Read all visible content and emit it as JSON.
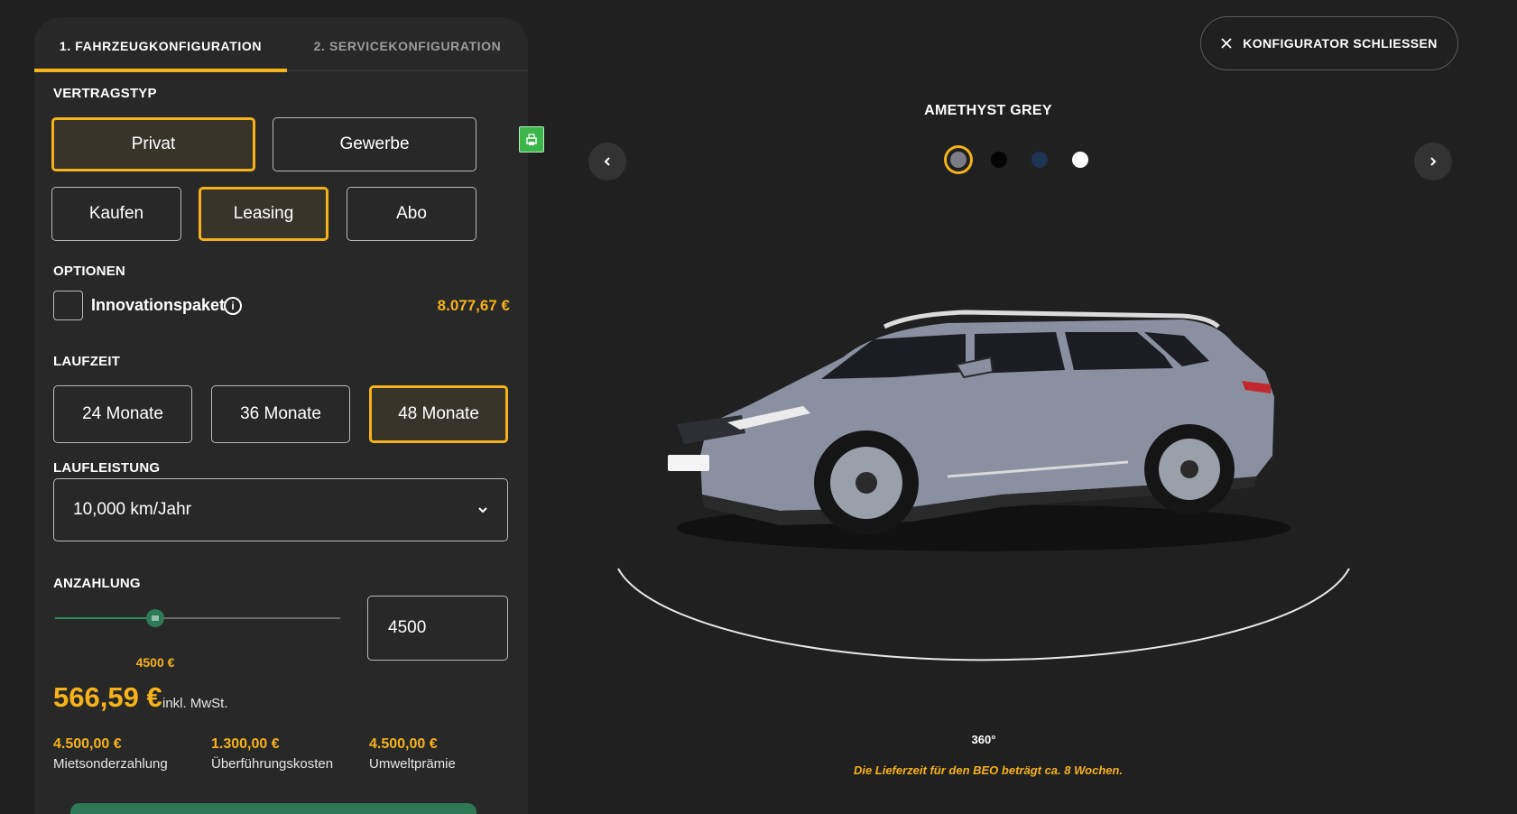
{
  "tabs": [
    {
      "label": "1. FAHRZEUGKONFIGURATION",
      "active": true
    },
    {
      "label": "2. SERVICEKONFIGURATION",
      "active": false
    }
  ],
  "contract": {
    "label": "VERTRAGSTYP",
    "customer_types": [
      {
        "label": "Privat",
        "selected": true
      },
      {
        "label": "Gewerbe",
        "selected": false
      }
    ],
    "purchase_types": [
      {
        "label": "Kaufen",
        "selected": false
      },
      {
        "label": "Leasing",
        "selected": true
      },
      {
        "label": "Abo",
        "selected": false
      }
    ]
  },
  "options": {
    "label": "OPTIONEN",
    "innovation_package": {
      "label": "Innovationspaket",
      "price": "8.077,67 €",
      "checked": false,
      "info_icon": "info-icon"
    }
  },
  "term": {
    "label": "LAUFZEIT",
    "items": [
      {
        "label": "24 Monate",
        "selected": false
      },
      {
        "label": "36 Monate",
        "selected": false
      },
      {
        "label": "48 Monate",
        "selected": true
      }
    ]
  },
  "mileage": {
    "label": "LAUFLEISTUNG",
    "selected": "10,000 km/Jahr"
  },
  "deposit": {
    "label": "ANZAHLUNG",
    "slider_label": "4500 €",
    "input_value": "4500",
    "fraction": 0.35
  },
  "price": {
    "monthly": "566,59 €",
    "note": "inkl. MwSt."
  },
  "costs": [
    {
      "value": "4.500,00 €",
      "label": "Mietsonderzahlung"
    },
    {
      "value": "1.300,00 €",
      "label": "Überführungskosten"
    },
    {
      "value": "4.500,00 €",
      "label": "Umweltprämie"
    }
  ],
  "viewer": {
    "close_label": "KONFIGURATOR SCHLIESSEN",
    "color_name": "AMETHYST GREY",
    "swatches": [
      {
        "name": "Amethyst Grey",
        "hex": "#7c7c86",
        "selected": true
      },
      {
        "name": "Black",
        "hex": "#050505",
        "selected": false
      },
      {
        "name": "Blue",
        "hex": "#1f3355",
        "selected": false
      },
      {
        "name": "White",
        "hex": "#ffffff",
        "selected": false
      }
    ],
    "rotate_label": "360°",
    "delivery_note": "Die Lieferzeit für den BEO beträgt ca. 8 Wochen."
  },
  "colors": {
    "accent": "#f5b21a",
    "green": "#2e7a57",
    "panel": "#282828",
    "background": "#202020"
  }
}
